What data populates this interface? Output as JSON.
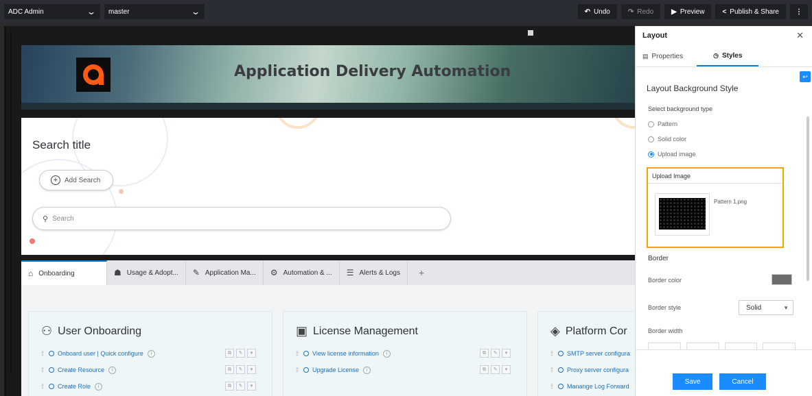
{
  "topbar": {
    "app_select": "ADC Admin",
    "branch_select": "master",
    "undo": "Undo",
    "redo": "Redo",
    "preview": "Preview",
    "publish": "Publish & Share"
  },
  "banner": {
    "title": "Application Delivery Automation"
  },
  "search_panel": {
    "title": "Search title",
    "add_search": "Add Search",
    "search_placeholder": "Search"
  },
  "tabs": [
    {
      "label": "Onboarding",
      "icon": "home-icon",
      "active": true
    },
    {
      "label": "Usage & Adopt...",
      "icon": "people-chart-icon"
    },
    {
      "label": "Application Ma...",
      "icon": "edit-doc-icon"
    },
    {
      "label": "Automation & ...",
      "icon": "automation-icon"
    },
    {
      "label": "Alerts & Logs",
      "icon": "log-icon"
    }
  ],
  "cards": [
    {
      "title": "User Onboarding",
      "icon": "users-icon",
      "items": [
        "Onboard user | Quick configure",
        "Create Resource",
        "Create Role"
      ]
    },
    {
      "title": "License Management",
      "icon": "license-icon",
      "items": [
        "View license information",
        "Upgrade License"
      ]
    },
    {
      "title": "Platform Cor",
      "icon": "layers-icon",
      "items": [
        "SMTP server configura",
        "Proxy server configura",
        "Manange Log Forward"
      ]
    }
  ],
  "panel": {
    "title": "Layout",
    "tab_properties": "Properties",
    "tab_styles": "Styles",
    "section_title": "Layout Background Style",
    "select_label": "Select background type",
    "options": [
      "Pattern",
      "Solid color",
      "Upload image"
    ],
    "selected_option": "Upload image",
    "upload_title": "Upload Image",
    "file_name": "Pattern 1.png",
    "border_label": "Border",
    "border_color_label": "Border color",
    "border_color": "#6b6c6e",
    "border_style_label": "Border style",
    "border_style_value": "Solid",
    "border_width_label": "Border width",
    "save": "Save",
    "cancel": "Cancel"
  },
  "colors": {
    "accent": "#1a8cff",
    "highlight": "#f0a500",
    "logo": "#ff5a14"
  }
}
